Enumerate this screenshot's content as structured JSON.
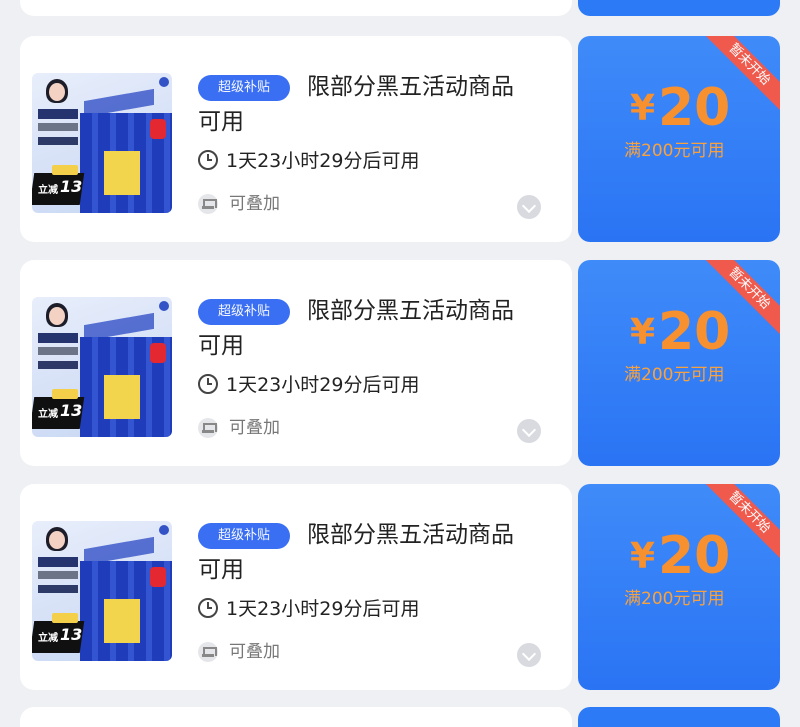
{
  "coupons": [
    {
      "badge": "超级补贴",
      "title_line1": "限部分黑五活动商品",
      "title_line2": "可用",
      "timer": "1天23小时29分后可用",
      "stack": "可叠加",
      "ribbon": "暂未开始",
      "currency": "¥",
      "amount": "20",
      "condition": "满200元可用",
      "image": {
        "discount_label": "立减",
        "discount_number": "13"
      }
    },
    {
      "badge": "超级补贴",
      "title_line1": "限部分黑五活动商品",
      "title_line2": "可用",
      "timer": "1天23小时29分后可用",
      "stack": "可叠加",
      "ribbon": "暂未开始",
      "currency": "¥",
      "amount": "20",
      "condition": "满200元可用",
      "image": {
        "discount_label": "立减",
        "discount_number": "13"
      }
    },
    {
      "badge": "超级补贴",
      "title_line1": "限部分黑五活动商品",
      "title_line2": "可用",
      "timer": "1天23小时29分后可用",
      "stack": "可叠加",
      "ribbon": "暂未开始",
      "currency": "¥",
      "amount": "20",
      "condition": "满200元可用",
      "image": {
        "discount_label": "立减",
        "discount_number": "13"
      }
    }
  ],
  "colors": {
    "background": "#eef0f3",
    "card": "#ffffff",
    "coupon_blue": "#2d7af7",
    "price_orange": "#f7902f",
    "ribbon_red": "#ef5a4d",
    "badge_blue": "#3a6ff4"
  },
  "icons": [
    "clock-icon",
    "stack-icon",
    "chevron-down-icon"
  ]
}
